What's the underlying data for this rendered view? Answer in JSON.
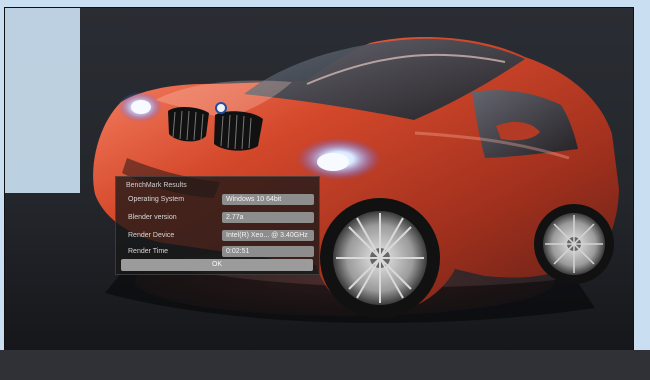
{
  "dialog": {
    "title": "BenchMark Results",
    "rows": [
      {
        "label": "Operating System",
        "value": "Windows 10 64bit"
      },
      {
        "label": "Blender version",
        "value": "2.77a"
      },
      {
        "label": "Render Device",
        "value": "Intel(R) Xeo... @ 3.40GHz"
      },
      {
        "label": "Render Time",
        "value": "0:02:51"
      }
    ],
    "ok_label": "OK"
  },
  "scene": {
    "car_color": "#d4482b",
    "background_color": "#23262b",
    "panel_color": "#c9def0"
  }
}
